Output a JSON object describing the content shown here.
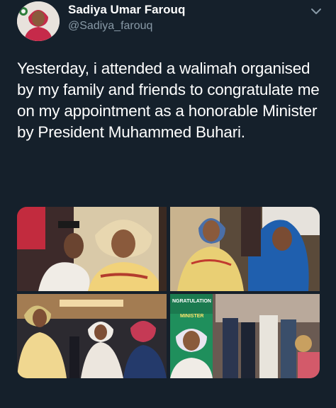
{
  "colors": {
    "background": "#15202b",
    "primary_text": "#ffffff",
    "secondary_text": "#8899a6",
    "link": "#1da1f2"
  },
  "tweet": {
    "author_name": "Sadiya Umar Farouq",
    "author_handle": "@Sadiya_farouq",
    "text": "Yesterday, i attended a walimah organised by my family and friends to congratulate me on my appointment as a honorable Minister by President Muhammed Buhari.",
    "menu_icon": "chevron-down-icon"
  },
  "media": {
    "photos": [
      {
        "id": "photo-1"
      },
      {
        "id": "photo-2"
      },
      {
        "id": "photo-3"
      },
      {
        "id": "photo-4",
        "banner_lines": [
          "NGRATULATION",
          "MINISTER"
        ]
      }
    ]
  }
}
